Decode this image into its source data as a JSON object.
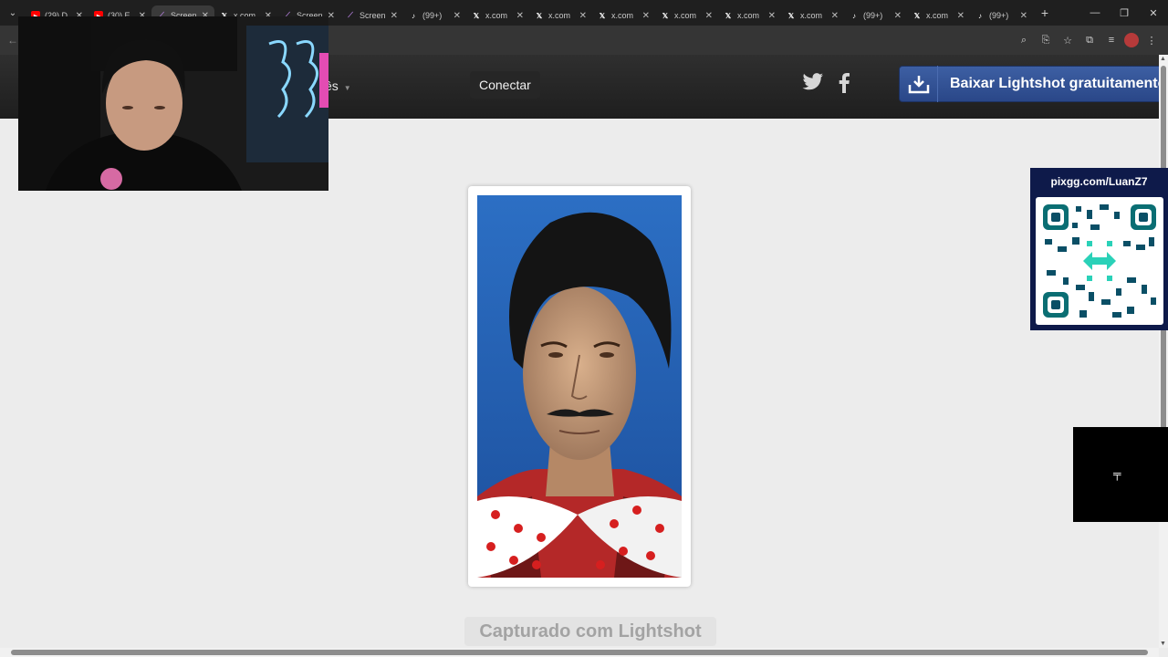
{
  "browser": {
    "tabs": [
      {
        "title": "(29) D",
        "icon": "youtube-icon",
        "color": "#ff0000",
        "active": false
      },
      {
        "title": "(30) E",
        "icon": "youtube-icon",
        "color": "#ff0000",
        "active": false
      },
      {
        "title": "Screen",
        "icon": "lightshot-feather-icon",
        "color": "#b07cd8",
        "active": true
      },
      {
        "title": "x.com",
        "icon": "x-icon",
        "color": "#ffffff",
        "active": false
      },
      {
        "title": "Screen",
        "icon": "lightshot-feather-icon",
        "color": "#b07cd8",
        "active": false
      },
      {
        "title": "Screen",
        "icon": "lightshot-feather-icon",
        "color": "#b07cd8",
        "active": false
      },
      {
        "title": "(99+)",
        "icon": "tiktok-icon",
        "color": "#ffffff",
        "active": false
      },
      {
        "title": "x.com",
        "icon": "x-icon",
        "color": "#ffffff",
        "active": false
      },
      {
        "title": "x.com",
        "icon": "x-icon",
        "color": "#ffffff",
        "active": false
      },
      {
        "title": "x.com",
        "icon": "x-icon",
        "color": "#ffffff",
        "active": false
      },
      {
        "title": "x.com",
        "icon": "x-icon",
        "color": "#ffffff",
        "active": false
      },
      {
        "title": "x.com",
        "icon": "x-icon",
        "color": "#ffffff",
        "active": false
      },
      {
        "title": "x.com",
        "icon": "x-icon",
        "color": "#ffffff",
        "active": false
      },
      {
        "title": "(99+)",
        "icon": "tiktok-icon",
        "color": "#ffffff",
        "active": false
      },
      {
        "title": "x.com",
        "icon": "x-icon",
        "color": "#ffffff",
        "active": false
      },
      {
        "title": "(99+)",
        "icon": "tiktok-icon",
        "color": "#ffffff",
        "active": false
      }
    ],
    "new_tab": "+",
    "window_controls": [
      "—",
      "❐",
      "✕"
    ]
  },
  "header": {
    "language_fragment": "ês",
    "connect_label": "Conectar",
    "twitter": "twitter-icon",
    "facebook": "facebook-icon",
    "download_label": "Baixar Lightshot gratuitamente"
  },
  "content": {
    "captured_label": "Capturado com Lightshot"
  },
  "overlay": {
    "pix_url": "pixgg.com/LuanZ7"
  },
  "colors": {
    "header_bg": "#262626",
    "download_blue": "#2f4f92",
    "page_bg": "#ececec",
    "pix_panel": "#0e1a4a"
  }
}
